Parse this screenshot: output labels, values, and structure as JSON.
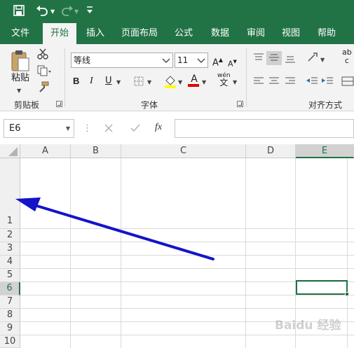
{
  "tabs": [
    "文件",
    "开始",
    "插入",
    "页面布局",
    "公式",
    "数据",
    "审阅",
    "视图",
    "帮助"
  ],
  "active_tab": "开始",
  "clipboard": {
    "paste_label": "粘贴",
    "group_label": "剪贴板"
  },
  "font": {
    "name": "等线",
    "size": "11",
    "group_label": "字体",
    "bold": "B",
    "italic": "I",
    "underline": "U",
    "grow": "A",
    "shrink": "A",
    "color_a": "A",
    "phonetic": "wén"
  },
  "alignment": {
    "group_label": "对齐方式",
    "wrap_partial": "ab"
  },
  "namebox": {
    "value": "E6"
  },
  "formula_bar": {
    "fx_label": "fx",
    "value": ""
  },
  "columns": [
    "A",
    "B",
    "C",
    "D",
    "E"
  ],
  "active_column": "E",
  "rows": [
    "1",
    "2",
    "3",
    "4",
    "5",
    "6",
    "7",
    "8",
    "9",
    "10"
  ],
  "active_row": "6",
  "watermark": "Baidu 经验",
  "colors": {
    "brand": "#217346",
    "arrow": "#1414c8"
  }
}
